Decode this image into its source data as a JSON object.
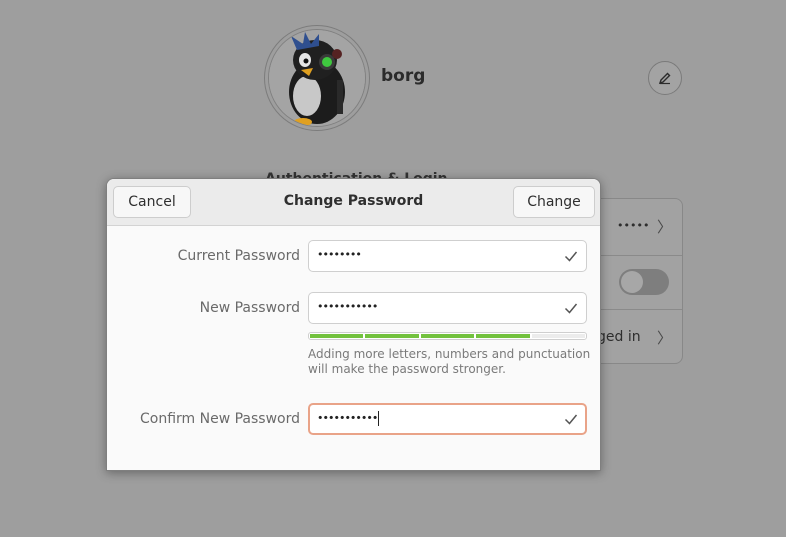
{
  "user": {
    "name": "borg",
    "section_title": "Authentication & Login"
  },
  "background": {
    "password_dots": "•••••",
    "logged_in_fragment": "ged in",
    "autologin_toggle": false
  },
  "dialog": {
    "title": "Change Password",
    "cancel_label": "Cancel",
    "change_label": "Change",
    "current_password": {
      "label": "Current Password",
      "value": "••••••••"
    },
    "new_password": {
      "label": "New Password",
      "value": "•••••••••••"
    },
    "confirm_password": {
      "label": "Confirm New Password",
      "value": "•••••••••••"
    },
    "strength_segments": 5,
    "strength_filled": 4,
    "hint": "Adding more letters, numbers and punctuation will make the password stronger.",
    "colors": {
      "accent_focus": "#e9a388",
      "strength": "#73c23e"
    }
  }
}
